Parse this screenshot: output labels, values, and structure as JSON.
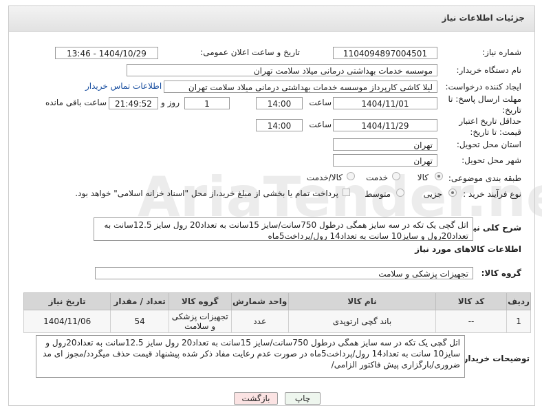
{
  "header": {
    "title": "جزئیات اطلاعات نیاز"
  },
  "fields": {
    "need_number_label": "شماره نیاز:",
    "need_number": "1104094897004501",
    "announce_label": "تاریخ و ساعت اعلان عمومی:",
    "announce_value": "1404/10/29 - 13:46",
    "buyer_org_label": "نام دستگاه خریدار:",
    "buyer_org": "موسسه خدمات بهداشتی درمانی میلاد سلامت تهران",
    "creator_label": "ایجاد کننده درخواست:",
    "creator": "لیلا کاشی کارپرداز موسسه خدمات بهداشتی درمانی میلاد سلامت تهران",
    "contact_link": "اطلاعات تماس خریدار",
    "reply_deadline_label": "مهلت ارسال پاسخ: تا تاریخ:",
    "reply_date": "1404/11/01",
    "time_label": "ساعت",
    "reply_time": "14:00",
    "days_value": "1",
    "days_label": "روز و",
    "remaining_time": "21:49:52",
    "remaining_label": "ساعت باقی مانده",
    "price_validity_label": "حداقل تاریخ اعتبار قیمت: تا تاریخ:",
    "validity_date": "1404/11/29",
    "validity_time": "14:00",
    "province_label": "استان محل تحویل:",
    "province": "تهران",
    "city_label": "شهر محل تحویل:",
    "city": "تهران",
    "category_label": "طبقه بندی موضوعی:",
    "category_options": [
      "کالا",
      "خدمت",
      "کالا/خدمت"
    ],
    "process_label": "نوع فرآیند خرید :",
    "process_options": [
      "جزیی",
      "متوسط"
    ],
    "payment_note": "پرداخت تمام یا بخشی از مبلغ خرید،از محل \"اسناد خزانه اسلامی\" خواهد بود.",
    "summary_label": "شرح کلی نیاز:",
    "summary": "اتل گچی یک تکه در سه سایز همگی درطول 750سانت/سایز 15سانت به تعداد20 رول سایز 12.5سانت به تعداد20رول و سایز10 سانت به تعداد14 رول/پرداخت5ماه"
  },
  "goods_section": {
    "title": "اطلاعات کالاهای مورد نیاز",
    "group_label": "گروه کالا:",
    "group_value": "تجهیزات پزشکی و سلامت"
  },
  "table": {
    "headers": [
      "ردیف",
      "کد کالا",
      "نام کالا",
      "واحد شمارش",
      "گروه کالا",
      "تعداد / مقدار",
      "تاریخ نیاز"
    ],
    "rows": [
      [
        "1",
        "--",
        "باند گچی ارتوپدی",
        "عدد",
        "تجهیزات پزشکی و سلامت",
        "54",
        "1404/11/06"
      ]
    ]
  },
  "buyer_notes": {
    "label": "توضیحات خریدار:",
    "text": "اتل گچی یک تکه در سه سایز همگی درطول 750سانت/سایز 15سانت به تعداد20 رول سایز 12.5سانت به تعداد20رول و سایز10 سانت به تعداد14 رول/پرداخت5ماه در صورت عدم رعایت مفاد ذکر شده پیشنهاد قیمت حذف میگردد/مجوز ای مد ضروری/بارگزاری پیش فاکتور الزامی/"
  },
  "buttons": {
    "print": "چاپ",
    "back": "بازگشت"
  },
  "watermark": "AriaTender.net",
  "colors": {
    "link": "#1a4fa0",
    "back_button_bg": "#fbe3e3",
    "print_button_bg": "#eef6ee"
  }
}
